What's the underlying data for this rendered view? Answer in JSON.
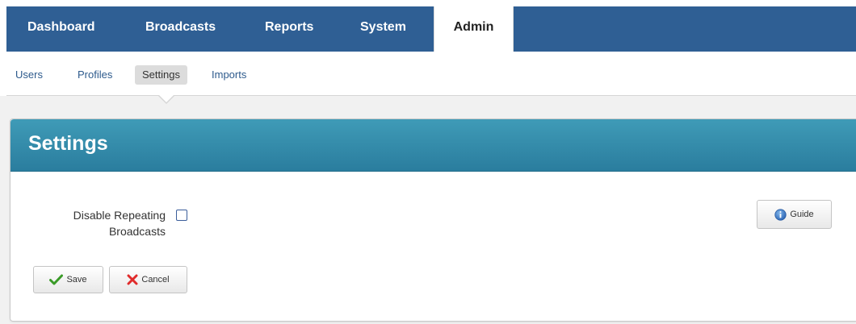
{
  "top_tabs": [
    {
      "label": "Dashboard"
    },
    {
      "label": "Broadcasts"
    },
    {
      "label": "Reports"
    },
    {
      "label": "System"
    },
    {
      "label": "Admin"
    }
  ],
  "sub_tabs": [
    {
      "label": "Users"
    },
    {
      "label": "Profiles"
    },
    {
      "label": "Settings"
    },
    {
      "label": "Imports"
    }
  ],
  "panel": {
    "title": "Settings",
    "guide_label": "Guide",
    "fields": {
      "disable_repeating": {
        "label_line1": "Disable Repeating",
        "label_line2": "Broadcasts",
        "checked": false
      }
    },
    "save_label": "Save",
    "cancel_label": "Cancel"
  },
  "colors": {
    "topbar": "#2f5f94",
    "panel_header": "#2a7d9e",
    "link": "#2d5a8c"
  },
  "icons": {
    "guide": "info-icon",
    "save": "check-icon",
    "cancel": "x-icon"
  }
}
